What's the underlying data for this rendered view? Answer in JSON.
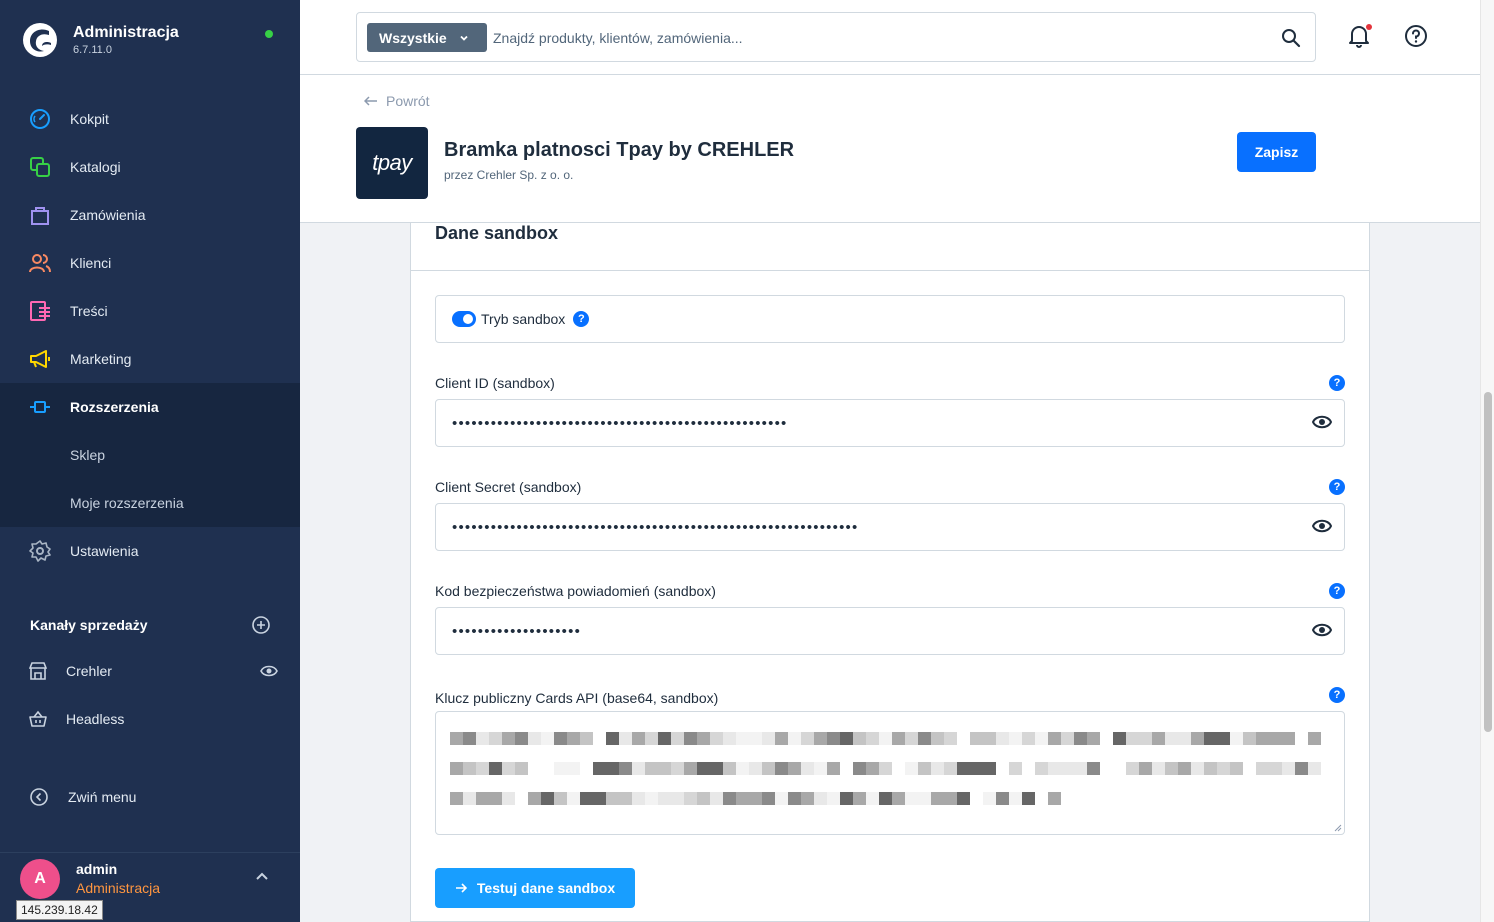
{
  "sidebar": {
    "brand_title": "Administracja",
    "brand_version": "6.7.11.0",
    "nav": [
      {
        "label": "Kokpit",
        "icon": "dashboard-icon",
        "color": "#189eff"
      },
      {
        "label": "Katalogi",
        "icon": "catalog-icon",
        "color": "#37d046"
      },
      {
        "label": "Zamówienia",
        "icon": "orders-bag-icon",
        "color": "#a092f0"
      },
      {
        "label": "Klienci",
        "icon": "customers-icon",
        "color": "#f88962"
      },
      {
        "label": "Treści",
        "icon": "content-icon",
        "color": "#ff68b4"
      },
      {
        "label": "Marketing",
        "icon": "megaphone-icon",
        "color": "#ffd700"
      },
      {
        "label": "Rozszerzenia",
        "icon": "plug-icon",
        "color": "#189eff"
      }
    ],
    "subnav": [
      "Sklep",
      "Moje rozszerzenia"
    ],
    "settings_label": "Ustawienia",
    "channels_title": "Kanały sprzedaży",
    "channels": [
      "Crehler",
      "Headless"
    ],
    "collapse_label": "Zwiń menu",
    "user": {
      "initial": "A",
      "name": "admin",
      "role": "Administracja"
    },
    "ip_tooltip": "145.239.18.42"
  },
  "topbar": {
    "search_type": "Wszystkie",
    "search_placeholder": "Znajdź produkty, klientów, zamówienia..."
  },
  "page": {
    "back_label": "Powrót",
    "logo_text": "tpay",
    "title": "Bramka platnosci Tpay by CREHLER",
    "author": "przez Crehler Sp. z o. o.",
    "save_label": "Zapisz"
  },
  "card": {
    "title": "Dane sandbox",
    "switch_label": "Tryb sandbox",
    "help_glyph": "?",
    "fields": [
      {
        "label": "Client ID (sandbox)",
        "masked": "••••••••••••••••••••••••••••••••••••••••••••••••••••"
      },
      {
        "label": "Client Secret (sandbox)",
        "masked": "•••••••••••••••••••••••••••••••••••••••••••••••••••••••••••••••"
      },
      {
        "label": "Kod bezpieczeństwa powiadomień (sandbox)",
        "masked": "••••••••••••••••••••"
      }
    ],
    "textarea_label": "Klucz publiczny Cards API (base64, sandbox)",
    "test_label": "Testuj dane sandbox"
  },
  "colors": {
    "sidebar_bg": "#1f3050",
    "primary": "#0870ff",
    "test_button": "#189eff",
    "online": "#37d046",
    "role": "#ff9640",
    "avatar": "#ee4f8b"
  }
}
